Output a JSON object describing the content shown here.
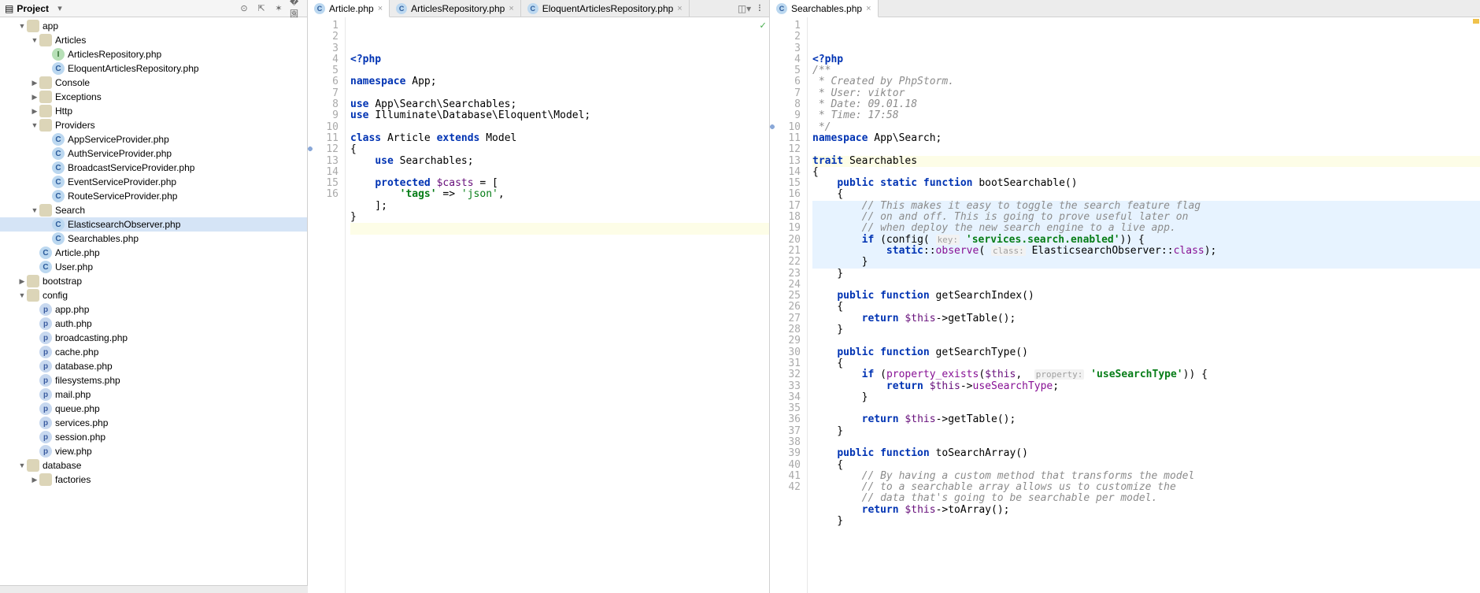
{
  "sidebar": {
    "title": "Project",
    "tools": [
      "target-icon",
      "collapse-icon",
      "settings-icon",
      "hide-icon"
    ],
    "tree": [
      {
        "d": 1,
        "exp": "open",
        "ico": "dir-o",
        "label": "app"
      },
      {
        "d": 2,
        "exp": "open",
        "ico": "dir-o",
        "label": "Articles"
      },
      {
        "d": 3,
        "exp": "none",
        "ico": "int",
        "label": "ArticlesRepository.php"
      },
      {
        "d": 3,
        "exp": "none",
        "ico": "cls",
        "label": "EloquentArticlesRepository.php"
      },
      {
        "d": 2,
        "exp": "closed",
        "ico": "dir",
        "label": "Console"
      },
      {
        "d": 2,
        "exp": "closed",
        "ico": "dir",
        "label": "Exceptions"
      },
      {
        "d": 2,
        "exp": "closed",
        "ico": "dir",
        "label": "Http"
      },
      {
        "d": 2,
        "exp": "open",
        "ico": "dir-o",
        "label": "Providers"
      },
      {
        "d": 3,
        "exp": "none",
        "ico": "cls",
        "label": "AppServiceProvider.php"
      },
      {
        "d": 3,
        "exp": "none",
        "ico": "cls",
        "label": "AuthServiceProvider.php"
      },
      {
        "d": 3,
        "exp": "none",
        "ico": "cls",
        "label": "BroadcastServiceProvider.php"
      },
      {
        "d": 3,
        "exp": "none",
        "ico": "cls",
        "label": "EventServiceProvider.php"
      },
      {
        "d": 3,
        "exp": "none",
        "ico": "cls",
        "label": "RouteServiceProvider.php"
      },
      {
        "d": 2,
        "exp": "open",
        "ico": "dir-o",
        "label": "Search"
      },
      {
        "d": 3,
        "exp": "none",
        "ico": "cls",
        "label": "ElasticsearchObserver.php",
        "sel": true
      },
      {
        "d": 3,
        "exp": "none",
        "ico": "cls",
        "label": "Searchables.php"
      },
      {
        "d": 2,
        "exp": "none",
        "ico": "cls",
        "label": "Article.php"
      },
      {
        "d": 2,
        "exp": "none",
        "ico": "cls",
        "label": "User.php"
      },
      {
        "d": 1,
        "exp": "closed",
        "ico": "dir",
        "label": "bootstrap"
      },
      {
        "d": 1,
        "exp": "open",
        "ico": "dir-o",
        "label": "config"
      },
      {
        "d": 2,
        "exp": "none",
        "ico": "php",
        "label": "app.php"
      },
      {
        "d": 2,
        "exp": "none",
        "ico": "php",
        "label": "auth.php"
      },
      {
        "d": 2,
        "exp": "none",
        "ico": "php",
        "label": "broadcasting.php"
      },
      {
        "d": 2,
        "exp": "none",
        "ico": "php",
        "label": "cache.php"
      },
      {
        "d": 2,
        "exp": "none",
        "ico": "php",
        "label": "database.php"
      },
      {
        "d": 2,
        "exp": "none",
        "ico": "php",
        "label": "filesystems.php"
      },
      {
        "d": 2,
        "exp": "none",
        "ico": "php",
        "label": "mail.php"
      },
      {
        "d": 2,
        "exp": "none",
        "ico": "php",
        "label": "queue.php"
      },
      {
        "d": 2,
        "exp": "none",
        "ico": "php",
        "label": "services.php"
      },
      {
        "d": 2,
        "exp": "none",
        "ico": "php",
        "label": "session.php"
      },
      {
        "d": 2,
        "exp": "none",
        "ico": "php",
        "label": "view.php"
      },
      {
        "d": 1,
        "exp": "open",
        "ico": "dir-o",
        "label": "database"
      },
      {
        "d": 2,
        "exp": "closed",
        "ico": "dir",
        "label": "factories"
      }
    ]
  },
  "leftPane": {
    "tabs": [
      {
        "label": "Article.php",
        "active": true
      },
      {
        "label": "ArticlesRepository.php"
      },
      {
        "label": "EloquentArticlesRepository.php"
      }
    ],
    "lines": 16,
    "code": [
      {
        "t": [
          {
            "c": "kw",
            "s": "<?php"
          }
        ]
      },
      {
        "t": []
      },
      {
        "t": [
          {
            "c": "kw",
            "s": "namespace "
          },
          {
            "s": "App;"
          }
        ]
      },
      {
        "t": []
      },
      {
        "t": [
          {
            "c": "kw",
            "s": "use "
          },
          {
            "s": "App\\Search\\Searchables;"
          }
        ]
      },
      {
        "t": [
          {
            "c": "kw",
            "s": "use "
          },
          {
            "s": "Illuminate\\Database\\Eloquent\\Model;"
          }
        ]
      },
      {
        "t": []
      },
      {
        "t": [
          {
            "c": "kw",
            "s": "class "
          },
          {
            "s": "Article "
          },
          {
            "c": "kw",
            "s": "extends "
          },
          {
            "s": "Model"
          }
        ]
      },
      {
        "t": [
          {
            "s": "{"
          }
        ]
      },
      {
        "t": [
          {
            "s": "    "
          },
          {
            "c": "kw",
            "s": "use "
          },
          {
            "s": "Searchables;"
          }
        ]
      },
      {
        "t": []
      },
      {
        "t": [
          {
            "s": "    "
          },
          {
            "c": "kw",
            "s": "protected "
          },
          {
            "c": "var",
            "s": "$casts"
          },
          {
            "s": " = ["
          }
        ],
        "mark": "impl"
      },
      {
        "t": [
          {
            "s": "        "
          },
          {
            "c": "str2",
            "s": "'tags'"
          },
          {
            "s": " => "
          },
          {
            "c": "str",
            "s": "'json'"
          },
          {
            "s": ","
          }
        ]
      },
      {
        "t": [
          {
            "s": "    ];"
          }
        ]
      },
      {
        "t": [
          {
            "s": "}"
          }
        ]
      },
      {
        "t": [],
        "cur": true
      }
    ]
  },
  "rightPane": {
    "tabs": [
      {
        "label": "Searchables.php",
        "active": true
      }
    ],
    "lines": 42,
    "code": [
      {
        "t": [
          {
            "c": "kw",
            "s": "<?php"
          }
        ]
      },
      {
        "t": [
          {
            "c": "com",
            "s": "/**"
          }
        ]
      },
      {
        "t": [
          {
            "c": "com",
            "s": " * Created by PhpStorm."
          }
        ]
      },
      {
        "t": [
          {
            "c": "com",
            "s": " * User: viktor"
          }
        ]
      },
      {
        "t": [
          {
            "c": "com",
            "s": " * Date: 09.01.18"
          }
        ]
      },
      {
        "t": [
          {
            "c": "com",
            "s": " * Time: 17:58"
          }
        ]
      },
      {
        "t": [
          {
            "c": "com",
            "s": " */"
          }
        ]
      },
      {
        "t": [
          {
            "c": "kw",
            "s": "namespace "
          },
          {
            "s": "App\\Search;"
          }
        ]
      },
      {
        "t": []
      },
      {
        "t": [
          {
            "c": "kw",
            "s": "trait "
          },
          {
            "s": "Searchables"
          }
        ],
        "cur": true,
        "mark": "impl"
      },
      {
        "t": [
          {
            "s": "{"
          }
        ]
      },
      {
        "t": [
          {
            "s": "    "
          },
          {
            "c": "kw",
            "s": "public static function "
          },
          {
            "s": "bootSearchable()"
          }
        ]
      },
      {
        "t": [
          {
            "s": "    {"
          }
        ]
      },
      {
        "t": [
          {
            "s": "        "
          },
          {
            "c": "com",
            "s": "// This makes it easy to toggle the search feature flag"
          }
        ],
        "ins": true
      },
      {
        "t": [
          {
            "s": "        "
          },
          {
            "c": "com",
            "s": "// on and off. This is going to prove useful later on"
          }
        ],
        "ins": true
      },
      {
        "t": [
          {
            "s": "        "
          },
          {
            "c": "com",
            "s": "// when deploy the new search engine to a live app."
          }
        ],
        "ins": true
      },
      {
        "t": [
          {
            "s": "        "
          },
          {
            "c": "kw",
            "s": "if "
          },
          {
            "s": "(config( "
          },
          {
            "c": "hint",
            "s": "key:"
          },
          {
            "s": " "
          },
          {
            "c": "str2",
            "s": "'services.search.enabled'"
          },
          {
            "s": ")) {"
          }
        ],
        "ins": true
      },
      {
        "t": [
          {
            "s": "            "
          },
          {
            "c": "kw",
            "s": "static"
          },
          {
            "s": "::"
          },
          {
            "c": "fld",
            "s": "observe"
          },
          {
            "s": "( "
          },
          {
            "c": "hint",
            "s": "class:"
          },
          {
            "s": " ElasticsearchObserver::"
          },
          {
            "c": "fld",
            "s": "class"
          },
          {
            "s": ");"
          }
        ],
        "ins": true
      },
      {
        "t": [
          {
            "s": "        }"
          }
        ],
        "ins": true
      },
      {
        "t": [
          {
            "s": "    }"
          }
        ]
      },
      {
        "t": []
      },
      {
        "t": [
          {
            "s": "    "
          },
          {
            "c": "kw",
            "s": "public function "
          },
          {
            "s": "getSearchIndex()"
          }
        ]
      },
      {
        "t": [
          {
            "s": "    {"
          }
        ]
      },
      {
        "t": [
          {
            "s": "        "
          },
          {
            "c": "kw",
            "s": "return "
          },
          {
            "c": "var",
            "s": "$this"
          },
          {
            "s": "->getTable();"
          }
        ]
      },
      {
        "t": [
          {
            "s": "    }"
          }
        ]
      },
      {
        "t": []
      },
      {
        "t": [
          {
            "s": "    "
          },
          {
            "c": "kw",
            "s": "public function "
          },
          {
            "s": "getSearchType()"
          }
        ]
      },
      {
        "t": [
          {
            "s": "    {"
          }
        ]
      },
      {
        "t": [
          {
            "s": "        "
          },
          {
            "c": "kw",
            "s": "if "
          },
          {
            "s": "("
          },
          {
            "c": "fld",
            "s": "property_exists"
          },
          {
            "s": "("
          },
          {
            "c": "var",
            "s": "$this"
          },
          {
            "s": ",  "
          },
          {
            "c": "hint",
            "s": "property:"
          },
          {
            "s": " "
          },
          {
            "c": "str2",
            "s": "'useSearchType'"
          },
          {
            "s": ")) {"
          }
        ]
      },
      {
        "t": [
          {
            "s": "            "
          },
          {
            "c": "kw",
            "s": "return "
          },
          {
            "c": "var",
            "s": "$this"
          },
          {
            "s": "->"
          },
          {
            "c": "fld",
            "s": "useSearchType"
          },
          {
            "s": ";"
          }
        ]
      },
      {
        "t": [
          {
            "s": "        }"
          }
        ]
      },
      {
        "t": []
      },
      {
        "t": [
          {
            "s": "        "
          },
          {
            "c": "kw",
            "s": "return "
          },
          {
            "c": "var",
            "s": "$this"
          },
          {
            "s": "->getTable();"
          }
        ]
      },
      {
        "t": [
          {
            "s": "    }"
          }
        ]
      },
      {
        "t": []
      },
      {
        "t": [
          {
            "s": "    "
          },
          {
            "c": "kw",
            "s": "public function "
          },
          {
            "s": "toSearchArray()"
          }
        ]
      },
      {
        "t": [
          {
            "s": "    {"
          }
        ]
      },
      {
        "t": [
          {
            "s": "        "
          },
          {
            "c": "com",
            "s": "// By having a custom method that transforms the model"
          }
        ]
      },
      {
        "t": [
          {
            "s": "        "
          },
          {
            "c": "com",
            "s": "// to a searchable array allows us to customize the"
          }
        ]
      },
      {
        "t": [
          {
            "s": "        "
          },
          {
            "c": "com",
            "s": "// data that's going to be searchable per model."
          }
        ]
      },
      {
        "t": [
          {
            "s": "        "
          },
          {
            "c": "kw",
            "s": "return "
          },
          {
            "c": "var",
            "s": "$this"
          },
          {
            "s": "->toArray();"
          }
        ]
      },
      {
        "t": [
          {
            "s": "    }"
          }
        ]
      }
    ]
  }
}
